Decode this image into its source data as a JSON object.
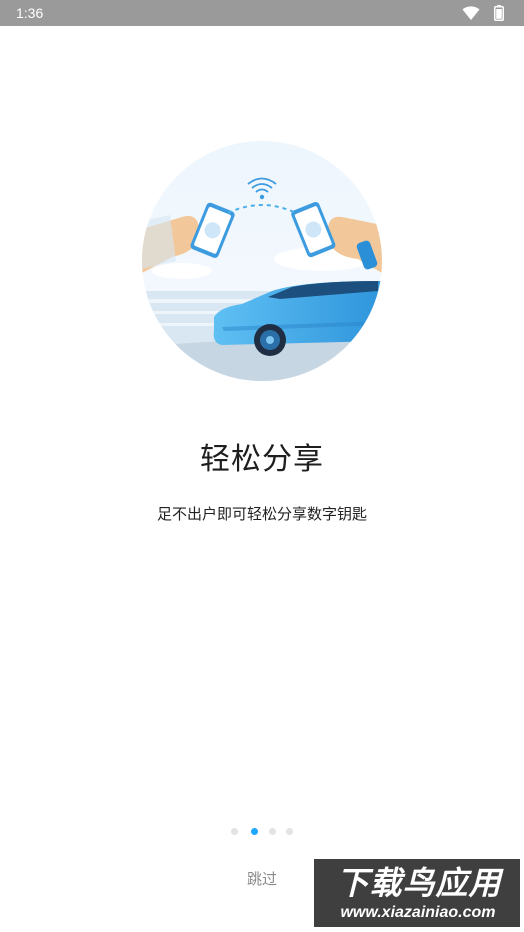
{
  "status_bar": {
    "time": "1:36",
    "wifi_icon": "wifi-icon",
    "battery_icon": "battery-icon"
  },
  "illustration": {
    "name": "phone-share-car-illustration"
  },
  "onboarding": {
    "title": "轻松分享",
    "subtitle": "足不出户即可轻松分享数字钥匙",
    "page_indicator": {
      "count": 4,
      "active_index": 1
    }
  },
  "skip_label": "跳过",
  "watermark": {
    "title": "下载鸟应用",
    "url": "www.xiazainiao.com"
  },
  "colors": {
    "accent": "#1ea7ff",
    "car": "#4db3ef",
    "dot_inactive": "#e3e3e3"
  }
}
